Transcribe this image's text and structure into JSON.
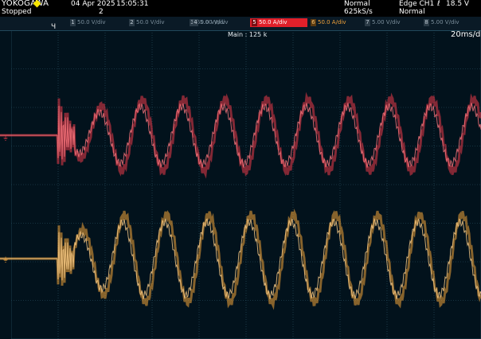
{
  "header": {
    "brand": "YOKOGAWA",
    "run_state": "Stopped",
    "date": "04 Apr 2025",
    "time": "15:05:31",
    "record_count": "2",
    "acq_mode": "Normal",
    "sample_rate": "625kS/s",
    "trigger_label": "Edge CH1",
    "trigger_level": "18.5 V",
    "trigger_mode": "Normal"
  },
  "channels": [
    {
      "id": "1",
      "label": "50.0 V/div"
    },
    {
      "id": "2",
      "label": "50.0 V/div"
    },
    {
      "id": "3",
      "label": "50.0 V/div"
    },
    {
      "id": "4",
      "label": "5.00 V/div"
    },
    {
      "id": "5",
      "label": "50.0 A/div",
      "state": "active"
    },
    {
      "id": "6",
      "label": "50.0 A/div",
      "state": "next"
    },
    {
      "id": "7",
      "label": "5.00 V/div"
    },
    {
      "id": "8",
      "label": "5.00 V/div"
    }
  ],
  "display": {
    "main_label": "Main : 125 k",
    "time_per_div": "20ms/di"
  },
  "colors": {
    "trace_ch5": "#ee3b4a",
    "trace_ch6": "#f5a53a",
    "grid": "#2a5466",
    "background": "#02121c"
  }
}
